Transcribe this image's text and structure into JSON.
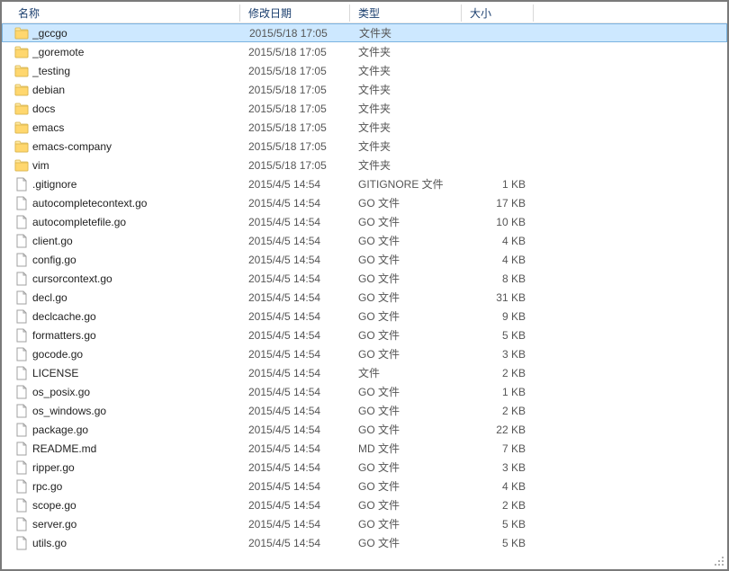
{
  "columns": {
    "name": "名称",
    "date": "修改日期",
    "type": "类型",
    "size": "大小"
  },
  "items": [
    {
      "name": "_gccgo",
      "date": "2015/5/18 17:05",
      "type": "文件夹",
      "size": "",
      "kind": "folder",
      "selected": true
    },
    {
      "name": "_goremote",
      "date": "2015/5/18 17:05",
      "type": "文件夹",
      "size": "",
      "kind": "folder"
    },
    {
      "name": "_testing",
      "date": "2015/5/18 17:05",
      "type": "文件夹",
      "size": "",
      "kind": "folder"
    },
    {
      "name": "debian",
      "date": "2015/5/18 17:05",
      "type": "文件夹",
      "size": "",
      "kind": "folder"
    },
    {
      "name": "docs",
      "date": "2015/5/18 17:05",
      "type": "文件夹",
      "size": "",
      "kind": "folder"
    },
    {
      "name": "emacs",
      "date": "2015/5/18 17:05",
      "type": "文件夹",
      "size": "",
      "kind": "folder"
    },
    {
      "name": "emacs-company",
      "date": "2015/5/18 17:05",
      "type": "文件夹",
      "size": "",
      "kind": "folder"
    },
    {
      "name": "vim",
      "date": "2015/5/18 17:05",
      "type": "文件夹",
      "size": "",
      "kind": "folder"
    },
    {
      "name": ".gitignore",
      "date": "2015/4/5 14:54",
      "type": "GITIGNORE 文件",
      "size": "1 KB",
      "kind": "file"
    },
    {
      "name": "autocompletecontext.go",
      "date": "2015/4/5 14:54",
      "type": "GO 文件",
      "size": "17 KB",
      "kind": "file"
    },
    {
      "name": "autocompletefile.go",
      "date": "2015/4/5 14:54",
      "type": "GO 文件",
      "size": "10 KB",
      "kind": "file"
    },
    {
      "name": "client.go",
      "date": "2015/4/5 14:54",
      "type": "GO 文件",
      "size": "4 KB",
      "kind": "file"
    },
    {
      "name": "config.go",
      "date": "2015/4/5 14:54",
      "type": "GO 文件",
      "size": "4 KB",
      "kind": "file"
    },
    {
      "name": "cursorcontext.go",
      "date": "2015/4/5 14:54",
      "type": "GO 文件",
      "size": "8 KB",
      "kind": "file"
    },
    {
      "name": "decl.go",
      "date": "2015/4/5 14:54",
      "type": "GO 文件",
      "size": "31 KB",
      "kind": "file"
    },
    {
      "name": "declcache.go",
      "date": "2015/4/5 14:54",
      "type": "GO 文件",
      "size": "9 KB",
      "kind": "file"
    },
    {
      "name": "formatters.go",
      "date": "2015/4/5 14:54",
      "type": "GO 文件",
      "size": "5 KB",
      "kind": "file"
    },
    {
      "name": "gocode.go",
      "date": "2015/4/5 14:54",
      "type": "GO 文件",
      "size": "3 KB",
      "kind": "file"
    },
    {
      "name": "LICENSE",
      "date": "2015/4/5 14:54",
      "type": "文件",
      "size": "2 KB",
      "kind": "file"
    },
    {
      "name": "os_posix.go",
      "date": "2015/4/5 14:54",
      "type": "GO 文件",
      "size": "1 KB",
      "kind": "file"
    },
    {
      "name": "os_windows.go",
      "date": "2015/4/5 14:54",
      "type": "GO 文件",
      "size": "2 KB",
      "kind": "file"
    },
    {
      "name": "package.go",
      "date": "2015/4/5 14:54",
      "type": "GO 文件",
      "size": "22 KB",
      "kind": "file"
    },
    {
      "name": "README.md",
      "date": "2015/4/5 14:54",
      "type": "MD 文件",
      "size": "7 KB",
      "kind": "file"
    },
    {
      "name": "ripper.go",
      "date": "2015/4/5 14:54",
      "type": "GO 文件",
      "size": "3 KB",
      "kind": "file"
    },
    {
      "name": "rpc.go",
      "date": "2015/4/5 14:54",
      "type": "GO 文件",
      "size": "4 KB",
      "kind": "file"
    },
    {
      "name": "scope.go",
      "date": "2015/4/5 14:54",
      "type": "GO 文件",
      "size": "2 KB",
      "kind": "file"
    },
    {
      "name": "server.go",
      "date": "2015/4/5 14:54",
      "type": "GO 文件",
      "size": "5 KB",
      "kind": "file"
    },
    {
      "name": "utils.go",
      "date": "2015/4/5 14:54",
      "type": "GO 文件",
      "size": "5 KB",
      "kind": "file"
    }
  ]
}
